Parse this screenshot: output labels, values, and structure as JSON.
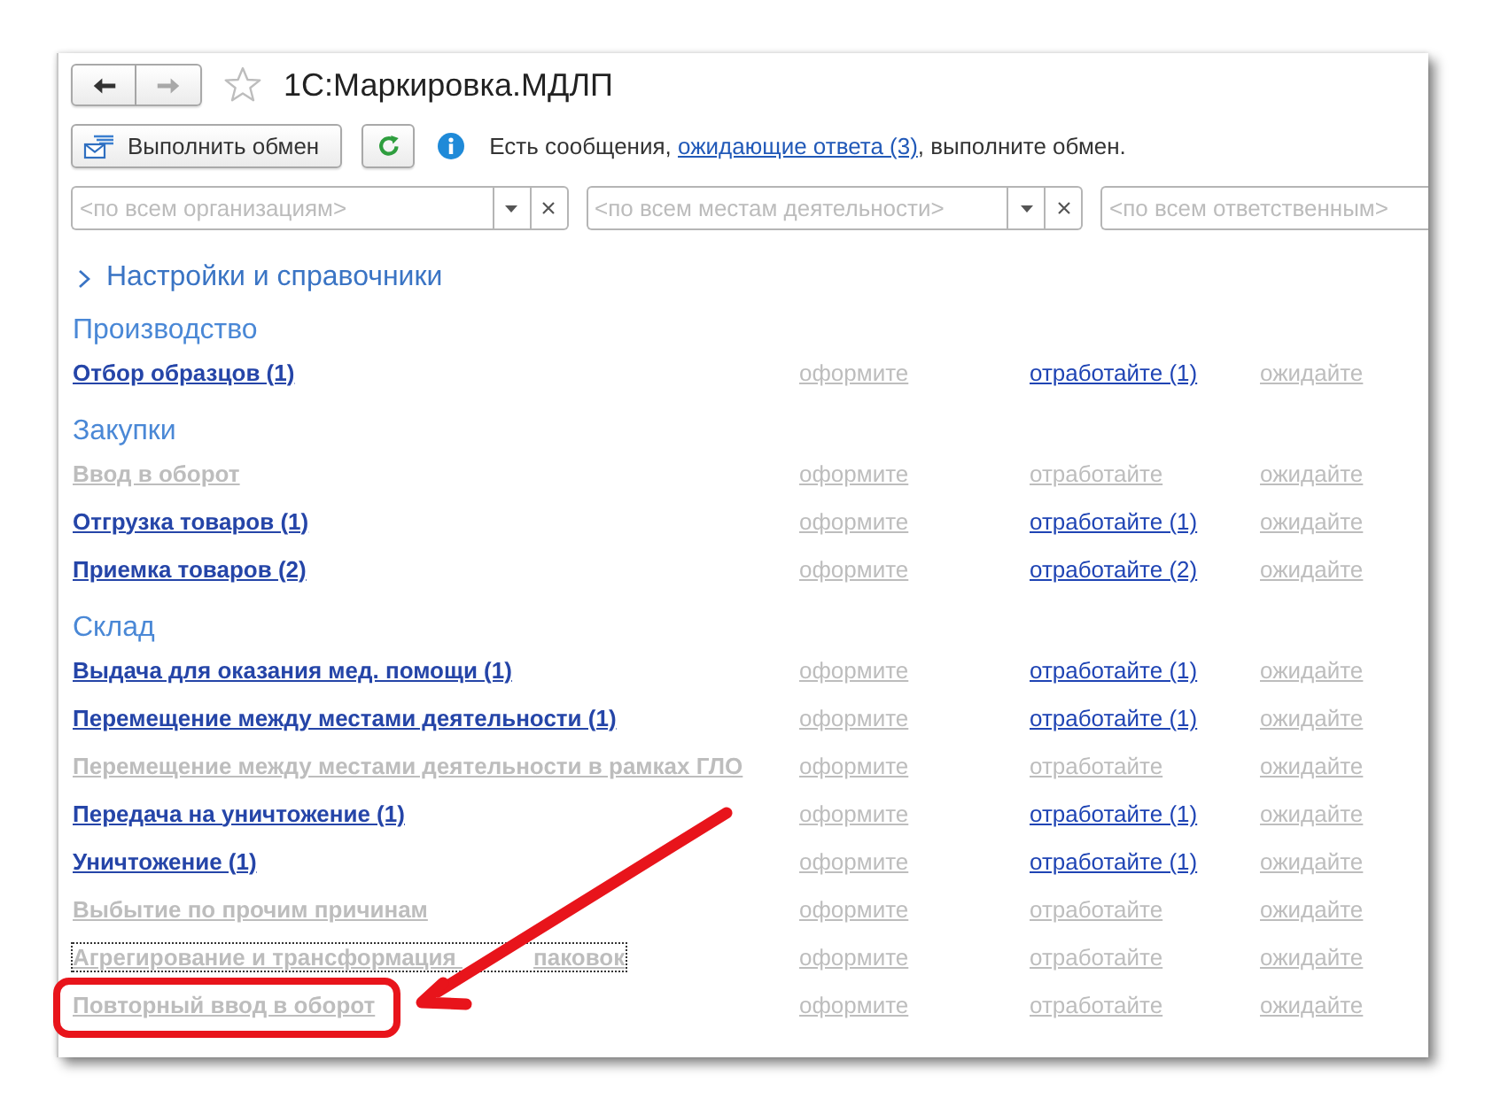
{
  "window": {
    "title": "1С:Маркировка.МДЛП",
    "favorite": false
  },
  "nav_buttons": [
    {
      "kind": "back",
      "disabled": false
    },
    {
      "kind": "forward",
      "disabled": true
    }
  ],
  "toolbar": {
    "exchange_button": "Выполнить обмен",
    "message": {
      "before": "Есть сообщения, ",
      "link": "ожидающие ответа (3)",
      "after": ", выполните обмен."
    }
  },
  "filters": [
    {
      "placeholder": "<по всем организациям>",
      "buttons": true
    },
    {
      "placeholder": "<по всем местам деятельности>",
      "buttons": true
    },
    {
      "placeholder": "<по всем ответственным>",
      "buttons": false
    }
  ],
  "settings_group": {
    "label": "Настройки и справочники",
    "expanded": false
  },
  "sections": [
    {
      "title": "Производство",
      "rows": [
        {
          "label": "Отбор образцов (1)",
          "active": true,
          "focused": false,
          "highlighted": false,
          "actions": [
            {
              "label": "оформите",
              "active": false
            },
            {
              "label": "отработайте (1)",
              "active": true
            },
            {
              "label": "ожидайте",
              "active": false
            }
          ]
        }
      ]
    },
    {
      "title": "Закупки",
      "rows": [
        {
          "label": "Ввод в оборот",
          "active": false,
          "focused": false,
          "highlighted": false,
          "actions": [
            {
              "label": "оформите",
              "active": false
            },
            {
              "label": "отработайте",
              "active": false
            },
            {
              "label": "ожидайте",
              "active": false
            }
          ]
        },
        {
          "label": "Отгрузка товаров (1)",
          "active": true,
          "focused": false,
          "highlighted": false,
          "actions": [
            {
              "label": "оформите",
              "active": false
            },
            {
              "label": "отработайте (1)",
              "active": true
            },
            {
              "label": "ожидайте",
              "active": false
            }
          ]
        },
        {
          "label": "Приемка товаров (2)",
          "active": true,
          "focused": false,
          "highlighted": false,
          "actions": [
            {
              "label": "оформите",
              "active": false
            },
            {
              "label": "отработайте (2)",
              "active": true
            },
            {
              "label": "ожидайте",
              "active": false
            }
          ]
        }
      ]
    },
    {
      "title": "Склад",
      "rows": [
        {
          "label": "Выдача для оказания мед. помощи (1)",
          "active": true,
          "focused": false,
          "highlighted": false,
          "actions": [
            {
              "label": "оформите",
              "active": false
            },
            {
              "label": "отработайте (1)",
              "active": true
            },
            {
              "label": "ожидайте",
              "active": false
            }
          ]
        },
        {
          "label": "Перемещение между местами деятельности (1)",
          "active": true,
          "focused": false,
          "highlighted": false,
          "actions": [
            {
              "label": "оформите",
              "active": false
            },
            {
              "label": "отработайте (1)",
              "active": true
            },
            {
              "label": "ожидайте",
              "active": false
            }
          ]
        },
        {
          "label": "Перемещение между местами деятельности в рамках ГЛО",
          "active": false,
          "focused": false,
          "highlighted": false,
          "actions": [
            {
              "label": "оформите",
              "active": false
            },
            {
              "label": "отработайте",
              "active": false
            },
            {
              "label": "ожидайте",
              "active": false
            }
          ]
        },
        {
          "label": "Передача на уничтожение (1)",
          "active": true,
          "focused": false,
          "highlighted": false,
          "actions": [
            {
              "label": "оформите",
              "active": false
            },
            {
              "label": "отработайте (1)",
              "active": true
            },
            {
              "label": "ожидайте",
              "active": false
            }
          ]
        },
        {
          "label": "Уничтожение (1)",
          "active": true,
          "focused": false,
          "highlighted": false,
          "actions": [
            {
              "label": "оформите",
              "active": false
            },
            {
              "label": "отработайте (1)",
              "active": true
            },
            {
              "label": "ожидайте",
              "active": false
            }
          ]
        },
        {
          "label": "Выбытие по прочим причинам",
          "active": false,
          "focused": false,
          "highlighted": false,
          "actions": [
            {
              "label": "оформите",
              "active": false
            },
            {
              "label": "отработайте",
              "active": false
            },
            {
              "label": "ожидайте",
              "active": false
            }
          ]
        },
        {
          "label": "Агрегирование и трансформация",
          "label_after_arrow": "паковок",
          "active": false,
          "focused": true,
          "highlighted": false,
          "actions": [
            {
              "label": "оформите",
              "active": false
            },
            {
              "label": "отработайте",
              "active": false
            },
            {
              "label": "ожидайте",
              "active": false
            }
          ]
        },
        {
          "label": "Повторный ввод в оборот",
          "active": false,
          "focused": false,
          "highlighted": true,
          "actions": [
            {
              "label": "оформите",
              "active": false
            },
            {
              "label": "отработайте",
              "active": false
            },
            {
              "label": "ожидайте",
              "active": false
            }
          ]
        }
      ]
    }
  ]
}
